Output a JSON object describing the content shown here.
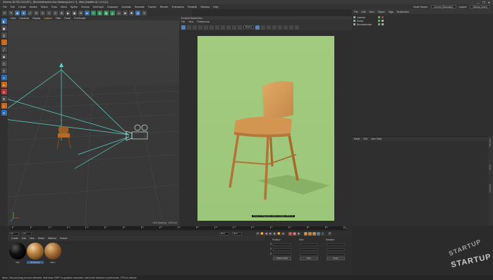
{
  "window": {
    "title": "Cinema 4D R21.115 (RC) - [Rochesterscene-Anz Samsung-Arn.1 *] - Main (Installer A)  1.4.4 (LI)",
    "controls": [
      "—",
      "❐",
      "✕"
    ]
  },
  "menubar": {
    "items": [
      "File",
      "Edit",
      "Create",
      "Modes",
      "Select",
      "Tools",
      "Mesh",
      "Spline",
      "Volume",
      "MoGraph",
      "Character",
      "Animate",
      "Simulate",
      "Tracker",
      "Render",
      "Extensions",
      "Redshift",
      "Window",
      "Help"
    ],
    "node_space_label": "Node Space:",
    "node_space_value": "Current (Standard)",
    "layout_label": "Layout:",
    "layout_value": "Startup (User)"
  },
  "viewport": {
    "menu": [
      "View",
      "Cameras",
      "Display",
      "Options",
      "Filter",
      "Panel",
      "ProRender"
    ],
    "highlight_index": 3,
    "perspective_label": "Perspective",
    "camera_label": "[Default Camera] ◆",
    "grid_spacing": "Grid Spacing : 1000 cm"
  },
  "render_view": {
    "tabs": [
      "Redshift RenderView"
    ],
    "menu": [
      "File",
      "View",
      "Preferences"
    ],
    "snapshot_select": "Beauty",
    "status_caption": "Frame 0  |  Progressive render complete | 00:01:23"
  },
  "object_manager": {
    "menu": [
      "File",
      "Edit",
      "View",
      "Object",
      "Tags",
      "Bookmarks"
    ],
    "objects": [
      "Camera",
      "Scene",
      "Rochesterclair"
    ]
  },
  "attributes": {
    "menu": [
      "Mode",
      "Edit",
      "User Data"
    ]
  },
  "right_tabs": [
    "Attributes",
    "Layers",
    "Structure"
  ],
  "timeline": {
    "ticks": [
      "0",
      "5",
      "10",
      "15",
      "20",
      "25",
      "30",
      "35",
      "40",
      "45",
      "50",
      "55",
      "60",
      "65",
      "70",
      "75",
      "80",
      "85",
      "90"
    ],
    "end_label": "0 F"
  },
  "transport": {
    "start_frame": "0 F",
    "current": "0 F",
    "end_frame": "90 F",
    "max_frame": "90 F"
  },
  "materials": {
    "menu": [
      "Create",
      "Edit",
      "View",
      "Select",
      "Material",
      "Texture"
    ],
    "items": [
      {
        "name": "Mat",
        "color": "#0b0b0b"
      },
      {
        "name": "Rochester",
        "color": "#9a6a3b"
      },
      {
        "name": "Mat.1",
        "color": "#8a5a2c"
      }
    ]
  },
  "coordinates": {
    "headers": [
      "Position",
      "Size",
      "Rotation"
    ],
    "axes": [
      "X",
      "Y",
      "Z"
    ],
    "values": [
      "0 cm",
      "0 cm",
      "0 cm"
    ],
    "object_mode": "Object (Rel)",
    "size_mode": "Size",
    "apply_button": "Apply"
  },
  "status": {
    "text": "Move: Click and drag to move elements. Hold down SHIFT to quantize movement / add to the selection in point mode, CTRL to remove."
  },
  "watermark": {
    "line1": "STARTUP",
    "line2": "STARTUP"
  }
}
